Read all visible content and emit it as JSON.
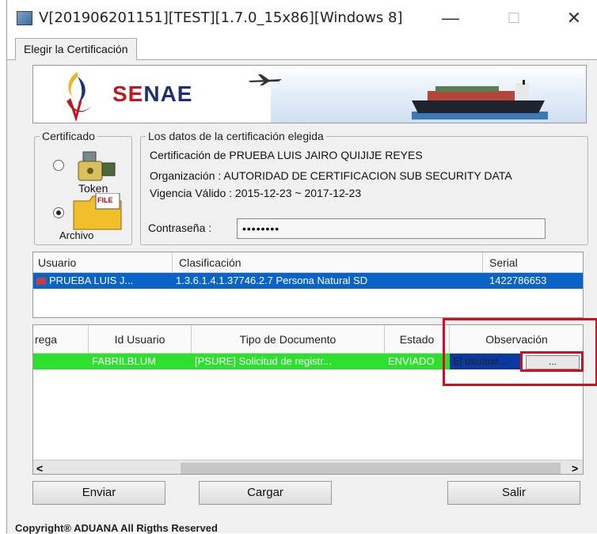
{
  "window": {
    "title": "V[201906201151][TEST][1.7.0_15x86][Windows 8]",
    "minimize": "—",
    "maximize": "☐",
    "close": "✕"
  },
  "tab": {
    "label": "Elegir la Certificación"
  },
  "banner": {
    "brand_part1": "SE",
    "brand_part2": "NAE"
  },
  "certificado": {
    "legend": "Certificado",
    "token_label": "Token",
    "archivo_label": "Archivo",
    "file_badge": "FILE",
    "selected": "Archivo"
  },
  "datos": {
    "legend": "Los datos de la certificación elegida",
    "certificacion": "Certificación de PRUEBA LUIS JAIRO QUIJIJE REYES",
    "organizacion": "Organización : AUTORIDAD DE CERTIFICACION SUB SECURITY DATA",
    "vigencia": "Vigencia Válido : 2015-12-23 ~ 2017-12-23",
    "password_label": "Contraseña :",
    "password_value": "••••••••"
  },
  "users_table": {
    "headers": [
      "Usuario",
      "Clasificación",
      "Serial"
    ],
    "rows": [
      [
        "PRUEBA LUIS J...",
        "1.3.6.1.4.1.37746.2.7 Persona Natural SD",
        "1422786653"
      ]
    ]
  },
  "docs_table": {
    "headers": [
      "rega",
      "Id Usuario",
      "Tipo de Documento",
      "Estado",
      "Observación"
    ],
    "rows": [
      [
        "",
        "FABRILBLUM",
        "[PSURE] Solicitud de registr...",
        "ENVIADO",
        "El usuario..."
      ]
    ],
    "more_button": "..."
  },
  "scrollbar": {
    "left": "<",
    "right": ">"
  },
  "buttons": {
    "enviar": "Enviar",
    "cargar": "Cargar",
    "salir": "Salir"
  },
  "status": "Copyright® ADUANA All Rigths Reserved",
  "colors": {
    "selection": "#0a64c8",
    "row_green": "#2ee02e",
    "highlight": "#d01020"
  }
}
